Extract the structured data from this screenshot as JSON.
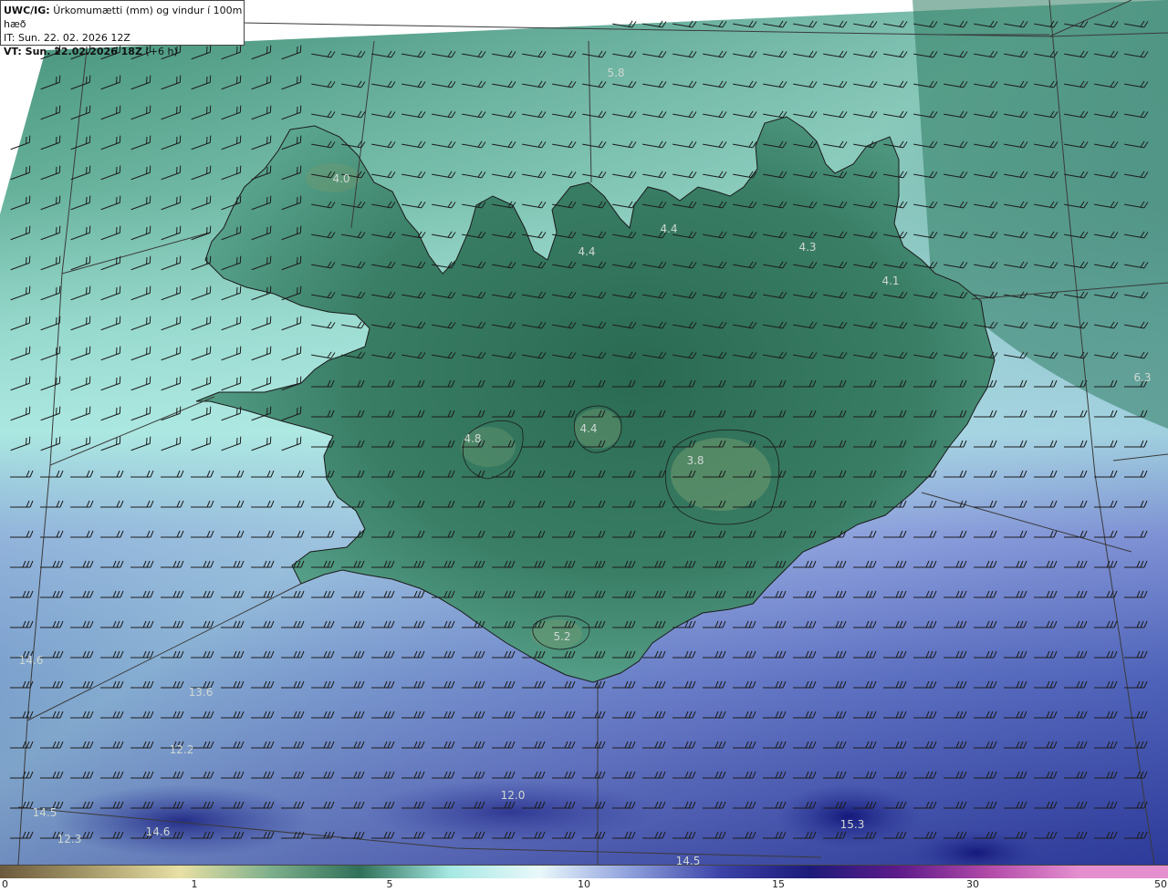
{
  "header": {
    "model": "UWC/IG:",
    "variable": "Úrkomumætti (mm) og vindur í 100m hæð",
    "init_line": "IT: Sun. 22. 02. 2026 12Z",
    "valid_prefix": "VT: Sun. 22.02.2026 18Z",
    "valid_suffix": "(+6 h)"
  },
  "colors": {
    "land_dark": "#2d6a55",
    "sea_light": "#a9e7e0",
    "sea_blue": "#4a5fb8",
    "sea_deep": "#1f2a8a",
    "coast": "#1a1a1a",
    "graticule": "#3a3a3a",
    "barb": "#1c1c1c",
    "value_label": "#cfd8d2"
  },
  "value_labels": [
    "5.8",
    "4.0",
    "4.4",
    "4.4",
    "4.3",
    "4.1",
    "6.3",
    "4.8",
    "4.4",
    "3.8",
    "5.2",
    "14.6",
    "13.6",
    "12.2",
    "12.0",
    "14.5",
    "12.3",
    "14.6",
    "15.3",
    "14.5"
  ],
  "colorbar": {
    "ticks": [
      "0",
      "1",
      "5",
      "10",
      "15",
      "30",
      "50"
    ],
    "colors": [
      "#6b5a3c",
      "#a79a6a",
      "#e8e0a4",
      "#7fb08c",
      "#2f7059",
      "#a5e8e2",
      "#eaf8fb",
      "#8fa0dc",
      "#3d44a8",
      "#1c1b7a",
      "#5e1b8a",
      "#b24aa8",
      "#e58fcf"
    ]
  }
}
